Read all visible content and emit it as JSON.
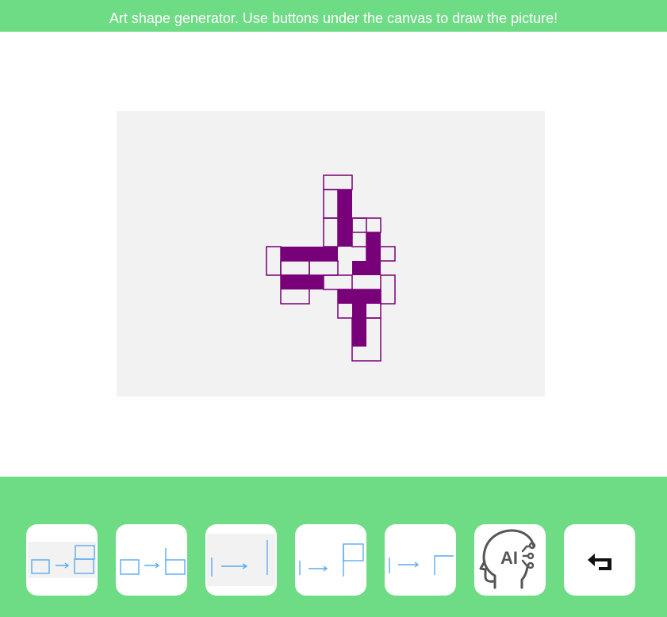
{
  "header": {
    "title": "Art shape generator. Use buttons under the canvas to draw the picture!"
  },
  "colors": {
    "bar": "#6edc84",
    "canvas": "#f2f2f2",
    "shape": "#780078",
    "sketch": "#5aaaf0",
    "ai_icon": "#555555"
  },
  "toolbar": {
    "buttons": [
      {
        "icon": "square-to-two-stacked-squares-icon"
      },
      {
        "icon": "square-to-l-squares-icon"
      },
      {
        "icon": "line-to-long-line-icon"
      },
      {
        "icon": "line-to-flag-icon"
      },
      {
        "icon": "line-to-corner-icon"
      },
      {
        "icon": "ai-head-icon",
        "label": "AI"
      },
      {
        "icon": "undo-arrow-icon"
      }
    ]
  }
}
